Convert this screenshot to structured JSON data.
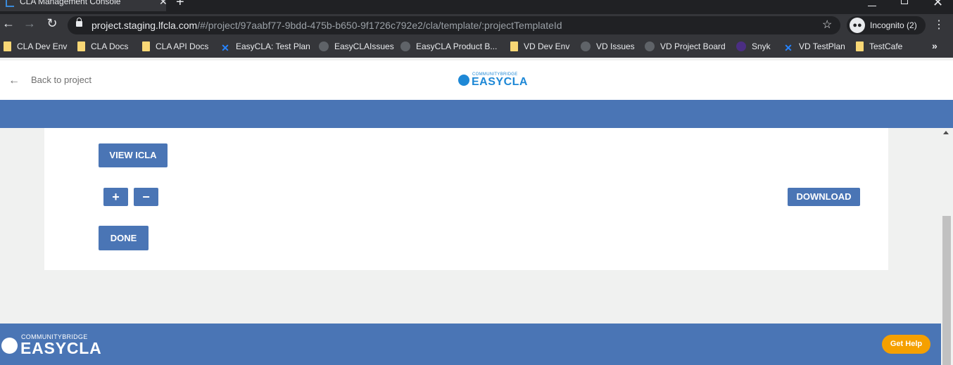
{
  "browser": {
    "tab_title": "CLA Management Console",
    "url_host": "project.staging.lfcla.com",
    "url_path": "/#/project/97aabf77-9bdd-475b-b650-9f1726c792e2/cla/template/:projectTemplateId",
    "profile_label": "Incognito (2)",
    "bookmarks": [
      {
        "label": "CLA Dev Env",
        "icon": "folder-icon"
      },
      {
        "label": "CLA Docs",
        "icon": "folder-icon"
      },
      {
        "label": "CLA API Docs",
        "icon": "folder-icon"
      },
      {
        "label": "EasyCLA: Test Plan",
        "icon": "jira-icon"
      },
      {
        "label": "EasyCLAIssues",
        "icon": "github-icon"
      },
      {
        "label": "EasyCLA Product B...",
        "icon": "github-icon"
      },
      {
        "label": "VD Dev Env",
        "icon": "folder-icon"
      },
      {
        "label": "VD Issues",
        "icon": "github-icon"
      },
      {
        "label": "VD Project Board",
        "icon": "github-icon"
      },
      {
        "label": "Snyk",
        "icon": "snyk-icon"
      },
      {
        "label": "VD TestPlan",
        "icon": "jira-icon"
      },
      {
        "label": "TestCafe",
        "icon": "folder-icon"
      }
    ]
  },
  "header": {
    "back_label": "Back to project",
    "logo_small": "COMMUNITYBRIDGE",
    "logo_big": "EASYCLA"
  },
  "card": {
    "view_label": "VIEW ICLA",
    "zoom_in_label": "+",
    "zoom_out_label": "−",
    "download_label": "DOWNLOAD",
    "done_label": "DONE"
  },
  "footer": {
    "logo_small": "COMMUNITYBRIDGE",
    "logo_big": "EASYCLA",
    "help_label": "Get Help"
  },
  "colors": {
    "brand_blue": "#4a75b5",
    "logo_blue": "#1e88d6",
    "help_orange": "#f5a000"
  }
}
